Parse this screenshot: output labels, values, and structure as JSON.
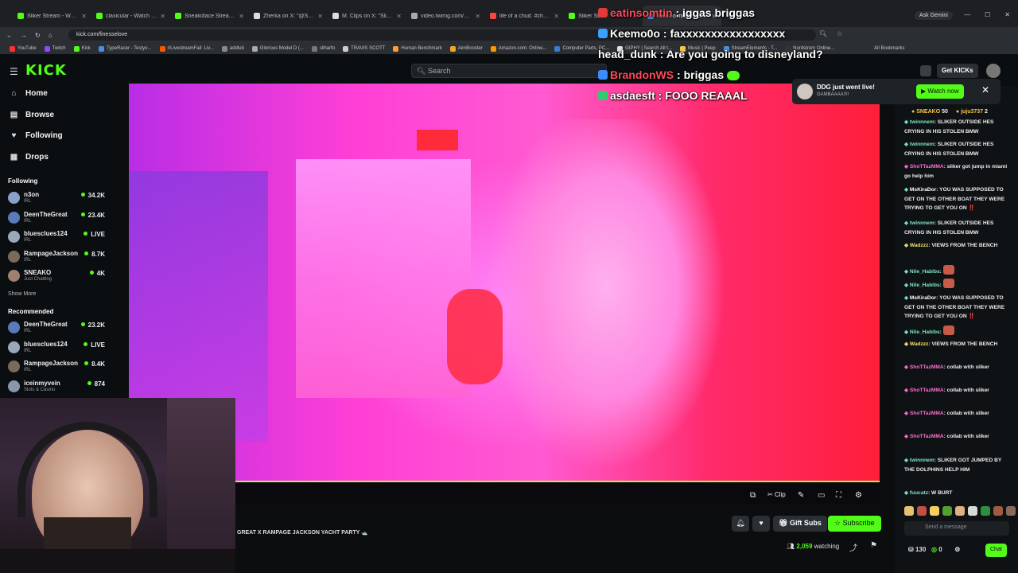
{
  "browser": {
    "tabs": [
      {
        "title": "Sliker Stream - Watch li",
        "color": "#53fc18"
      },
      {
        "title": "claxicular - Watch clip",
        "color": "#53fc18"
      },
      {
        "title": "Sneakoface Stream - W",
        "color": "#53fc18"
      },
      {
        "title": "Zherka on X: \"@Sliker",
        "color": "#dddddd"
      },
      {
        "title": "M. Clips on X: \"Sliker",
        "color": "#dddddd"
      },
      {
        "title": "video.twimg.com/amp",
        "color": "#aaaaaa"
      },
      {
        "title": "life of a chud. #chudma",
        "color": "#ff4444"
      },
      {
        "title": "Sliker Stre",
        "color": "#53fc18"
      },
      {
        "title": "heisk in miami - Goog",
        "color": "#4a90e2",
        "active": true
      }
    ],
    "ask_gemini": "Ask Gemini",
    "url": "kick.com/finesselove",
    "bookmarks": [
      "YouTube",
      "Twitch",
      "Kick",
      "TypeRacer - Testyo...",
      "r/LivestreamFail: Liv...",
      "addlub",
      "Glorious Model D (...",
      "sliharfo",
      "TRAVIS SCOTT",
      "Human Benchmark",
      "AimBooster",
      "Amazon.com: Online...",
      "Computer Parts, PC...",
      "GIPHY | Search All t...",
      "Music | Peep",
      "StreamElements - T...",
      "Nordstrom Online..."
    ],
    "all_bookmarks": "All Bookmarks"
  },
  "kick": {
    "logo": "KICK",
    "search_placeholder": "Search",
    "get_kicks": "Get KICKs",
    "nav": [
      {
        "label": "Home",
        "icon": "home-icon"
      },
      {
        "label": "Browse",
        "icon": "browse-icon"
      },
      {
        "label": "Following",
        "icon": "heart-icon"
      },
      {
        "label": "Drops",
        "icon": "drops-icon"
      }
    ],
    "following_header": "Following",
    "following": [
      {
        "name": "n3on",
        "category": "IRL",
        "viewers": "34.2K",
        "color": "#8aa0c8"
      },
      {
        "name": "DeenTheGreat",
        "category": "IRL",
        "viewers": "23.4K",
        "color": "#5a7ab8"
      },
      {
        "name": "bluesclues124",
        "category": "IRL",
        "viewers": "LIVE",
        "color": "#9aa8b8"
      },
      {
        "name": "RampageJackson",
        "category": "IRL",
        "viewers": "8.7K",
        "color": "#7a6a5a"
      },
      {
        "name": "SNEAKO",
        "category": "Just Chatting",
        "viewers": "4K",
        "color": "#a08070"
      }
    ],
    "show_more": "Show More",
    "recommended_header": "Recommended",
    "recommended": [
      {
        "name": "DeenTheGreat",
        "category": "IRL",
        "viewers": "23.2K",
        "color": "#5a7ab8"
      },
      {
        "name": "bluesclues124",
        "category": "IRL",
        "viewers": "LIVE",
        "color": "#9aa8b8"
      },
      {
        "name": "RampageJackson",
        "category": "IRL",
        "viewers": "8.4K",
        "color": "#7a6a5a"
      },
      {
        "name": "iceinmyvein",
        "category": "Slots & Casino",
        "viewers": "874",
        "color": "#8898a8"
      }
    ],
    "stream_title": "GREAT X RAMPAGE JACKSON YACHT PARTY 🛥️",
    "clip_label": "Clip",
    "gift_subs": "Gift Subs",
    "subscribe": "Subscribe",
    "watching_count": "2,059",
    "watching_label": "watching",
    "progress_fraction": 1.0
  },
  "toast": {
    "title": "DDG just went live!",
    "subtitle": "GAMBAAAA!!!!",
    "button": "Watch now"
  },
  "chat": {
    "pinned": [
      {
        "name": "SNEAKO",
        "value": "50"
      },
      {
        "name": "juju3737",
        "value": "2"
      }
    ],
    "messages": [
      {
        "user": "twinnnem",
        "cls": "gr",
        "text": "SLIKER OUTSIDE HES CRYING IN HIS STOLEN BMW"
      },
      {
        "user": "twinnnem",
        "cls": "gr",
        "text": "SLIKER OUTSIDE HES CRYING IN HIS STOLEN BMW"
      },
      {
        "user": "ShoTTazMMA",
        "cls": "pk",
        "text": "sliker got jump in miami go help him"
      },
      {
        "user": "MsKiraDor",
        "cls": "wh",
        "text": "YOU WAS SUPPOSED TO GET ON THE OTHER BOAT THEY WERE TRYING TO GET YOU ON ‼️"
      },
      {
        "user": "twinnnem",
        "cls": "gr",
        "text": "SLIKER OUTSIDE HES CRYING IN HIS STOLEN BMW"
      },
      {
        "user": "Wadzzz",
        "cls": "yl",
        "text": "VIEWS FROM THE BENCH"
      },
      {
        "user": "Nile_Habibs",
        "cls": "gr",
        "text": ""
      },
      {
        "user": "Nile_Habibs",
        "cls": "gr",
        "text": ""
      },
      {
        "user": "MsKiraDor",
        "cls": "wh",
        "text": "YOU WAS SUPPOSED TO GET ON THE OTHER BOAT THEY WERE TRYING TO GET YOU ON ‼️"
      },
      {
        "user": "Nile_Habibs",
        "cls": "gr",
        "text": ""
      },
      {
        "user": "Wadzzz",
        "cls": "yl",
        "text": "VIEWS FROM THE BENCH"
      },
      {
        "user": "ShoTTazMMA",
        "cls": "pk",
        "text": "collab with sliker"
      },
      {
        "user": "ShoTTazMMA",
        "cls": "pk",
        "text": "collab with sliker"
      },
      {
        "user": "ShoTTazMMA",
        "cls": "pk",
        "text": "collab with sliker"
      },
      {
        "user": "ShoTTazMMA",
        "cls": "pk",
        "text": "collab with sliker"
      },
      {
        "user": "twinnnem",
        "cls": "gr",
        "text": "SLIKER GOT JUMPED BY THE DOLPHINS HELP HIM"
      },
      {
        "user": "fuucatz",
        "cls": "gr",
        "text": "W BURT"
      }
    ],
    "send_placeholder": "Send a message",
    "points": "130",
    "points2": "0",
    "chat_button": "Chat"
  },
  "overlay": [
    {
      "name": "eatinsomtin",
      "text": "iggas briggas",
      "name_color": "red",
      "badge": "#e23a3a"
    },
    {
      "name": "Keemo0o",
      "text": "faxxxxxxxxxxxxxxxxx",
      "name_color": "white",
      "badge": "#3aa0ff"
    },
    {
      "name": "head_dunk",
      "text": "Are you going to disneyland?",
      "name_color": "white",
      "badge": ""
    },
    {
      "name": "BrandonWS",
      "text": "briggas",
      "name_color": "red",
      "badge": "#3a8cff"
    },
    {
      "name": "asdaesft",
      "text": "FOOO REAAAL",
      "name_color": "white",
      "badge": "#2ecc71"
    }
  ]
}
